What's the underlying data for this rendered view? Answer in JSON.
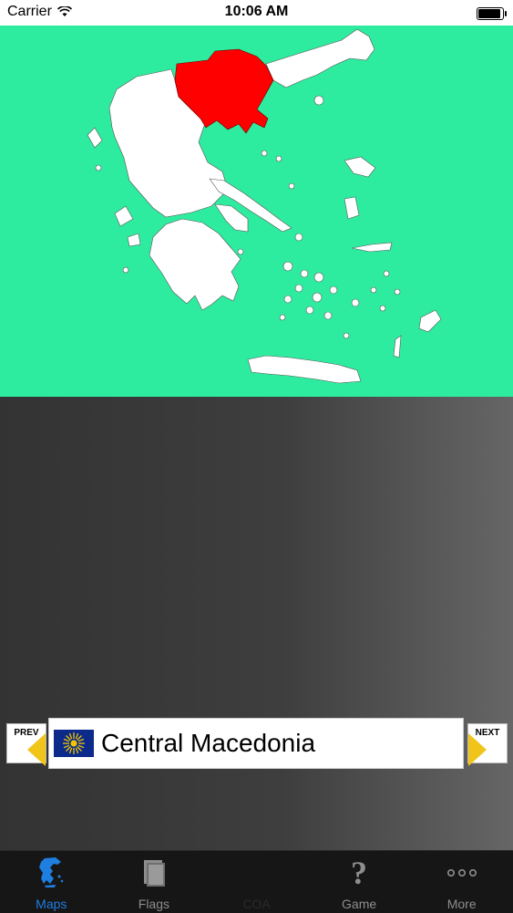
{
  "status_bar": {
    "carrier": "Carrier",
    "time": "10:06 AM"
  },
  "colors": {
    "map_background": "#2eec9f",
    "land": "#ffffff",
    "highlight_region": "#ff0000",
    "tab_active": "#1e7fe0"
  },
  "region_selector": {
    "prev_label": "PREV",
    "next_label": "NEXT",
    "region_name": "Central Macedonia",
    "flag_icon": "vergina-sun-flag-icon"
  },
  "tab_bar": {
    "tabs": [
      {
        "label": "Maps",
        "icon": "greece-map-icon",
        "active": true
      },
      {
        "label": "Flags",
        "icon": "flag-book-icon",
        "active": false
      },
      {
        "label": "COA",
        "icon": "coat-of-arms-icon",
        "active": false,
        "disabled": true
      },
      {
        "label": "Game",
        "icon": "question-mark-icon",
        "active": false
      },
      {
        "label": "More",
        "icon": "more-dots-icon",
        "active": false
      }
    ]
  }
}
